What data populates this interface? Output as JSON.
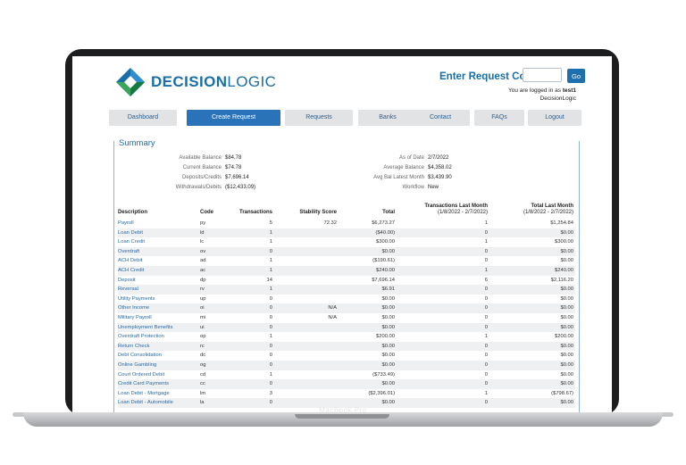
{
  "brand": {
    "name_bold": "DECISION",
    "name_light": "LOGIC"
  },
  "request": {
    "label": "Enter Request Code",
    "placeholder": "",
    "go_label": "Go"
  },
  "login": {
    "prefix": "You are logged in as",
    "user": "test1",
    "company": "DecisionLogic"
  },
  "nav": [
    {
      "label": "Dashboard",
      "active": false
    },
    {
      "label": "Create Request",
      "active": true
    },
    {
      "label": "Requests",
      "active": false
    },
    {
      "label": "Banks",
      "active": false
    },
    {
      "label": "Contact",
      "active": false
    },
    {
      "label": "FAQs",
      "active": false
    },
    {
      "label": "Logout",
      "active": false
    }
  ],
  "summary": {
    "title": "Summary",
    "left": [
      {
        "label": "Available Balance",
        "value": "$84.78"
      },
      {
        "label": "Current Balance",
        "value": "$74.78"
      },
      {
        "label": "Deposits/Credits",
        "value": "$7,696.14"
      },
      {
        "label": "Withdrawals/Debits",
        "value": "($12,433.09)"
      }
    ],
    "right": [
      {
        "label": "As of Date",
        "value": "2/7/2022"
      },
      {
        "label": "Average Balance",
        "value": "$4,358.02"
      },
      {
        "label": "Avg Bal Latest Month",
        "value": "$3,439.90"
      },
      {
        "label": "Workflow",
        "value": "New"
      }
    ]
  },
  "table": {
    "headers": {
      "description": "Description",
      "code": "Code",
      "transactions": "Transactions",
      "stability": "Stability Score",
      "total": "Total",
      "tlm": "Transactions Last Month",
      "tlm_range": "(1/8/2022 - 2/7/2022)",
      "totlm": "Total Last Month",
      "totlm_range": "(1/8/2022 - 2/7/2022)"
    },
    "rows": [
      [
        "Payroll",
        "py",
        "5",
        "72.32",
        "$6,273.27",
        "1",
        "$1,254.84"
      ],
      [
        "Loan Debit",
        "ld",
        "1",
        "",
        "($40.00)",
        "0",
        "$0.00"
      ],
      [
        "Loan Credit",
        "lc",
        "1",
        "",
        "$300.00",
        "1",
        "$300.00"
      ],
      [
        "Overdraft",
        "ov",
        "0",
        "",
        "$0.00",
        "0",
        "$0.00"
      ],
      [
        "ACH Debit",
        "ad",
        "1",
        "",
        "($190.61)",
        "0",
        "$0.00"
      ],
      [
        "ACH Credit",
        "ac",
        "1",
        "",
        "$240.00",
        "1",
        "$240.00"
      ],
      [
        "Deposit",
        "dp",
        "14",
        "",
        "$7,696.14",
        "6",
        "$2,116.20"
      ],
      [
        "Reversal",
        "rv",
        "1",
        "",
        "$6.91",
        "0",
        "$0.00"
      ],
      [
        "Utility Payments",
        "up",
        "0",
        "",
        "$0.00",
        "0",
        "$0.00"
      ],
      [
        "Other Income",
        "oi",
        "0",
        "N/A",
        "$0.00",
        "0",
        "$0.00"
      ],
      [
        "Military Payroll",
        "mi",
        "0",
        "N/A",
        "$0.00",
        "0",
        "$0.00"
      ],
      [
        "Unemployment Benefits",
        "ui",
        "0",
        "",
        "$0.00",
        "0",
        "$0.00"
      ],
      [
        "Overdraft Protection",
        "op",
        "1",
        "",
        "$200.00",
        "1",
        "$200.00"
      ],
      [
        "Return Check",
        "rc",
        "0",
        "",
        "$0.00",
        "0",
        "$0.00"
      ],
      [
        "Debt Consolidation",
        "dc",
        "0",
        "",
        "$0.00",
        "0",
        "$0.00"
      ],
      [
        "Online Gambling",
        "og",
        "0",
        "",
        "$0.00",
        "0",
        "$0.00"
      ],
      [
        "Court Ordered Debit",
        "cd",
        "1",
        "",
        "($733.49)",
        "0",
        "$0.00"
      ],
      [
        "Credit Card Payments",
        "cc",
        "0",
        "",
        "$0.00",
        "0",
        "$0.00"
      ],
      [
        "Loan Debit - Mortgage",
        "lm",
        "3",
        "",
        "($2,396.01)",
        "1",
        "($798.67)"
      ],
      [
        "Loan Debit - Automobile",
        "la",
        "0",
        "",
        "$0.00",
        "0",
        "$0.00"
      ]
    ]
  },
  "device": {
    "label": "MacBook Pro"
  },
  "colors": {
    "brand_blue": "#1a6ea8",
    "nav_active": "#2a73b8",
    "logo_green": "#3aa55d"
  }
}
